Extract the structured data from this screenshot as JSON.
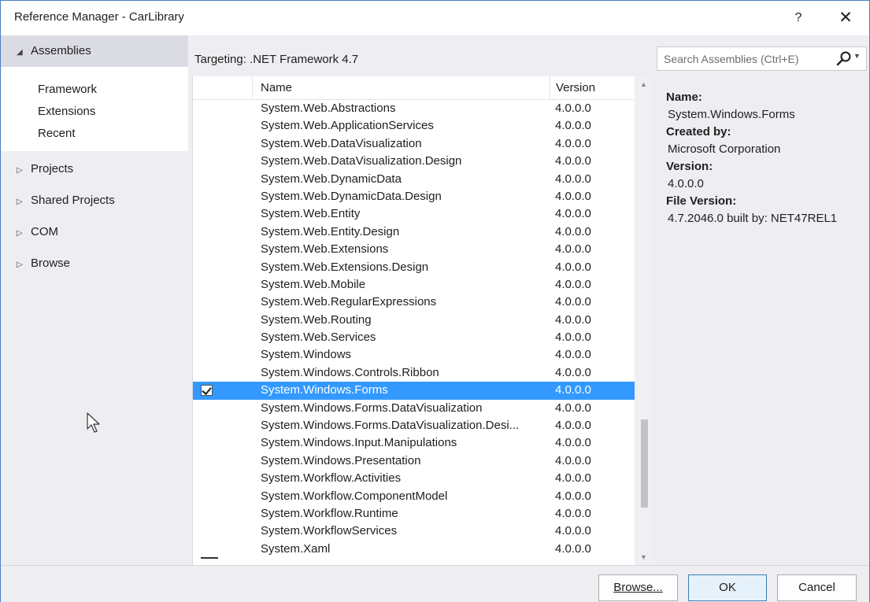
{
  "window": {
    "title": "Reference Manager - CarLibrary",
    "help": "?",
    "close": "✕"
  },
  "sidebar": {
    "assemblies": "Assemblies",
    "sub_items": [
      "Framework",
      "Extensions",
      "Recent"
    ],
    "nodes": [
      "Projects",
      "Shared Projects",
      "COM",
      "Browse"
    ]
  },
  "targeting": "Targeting: .NET Framework 4.7",
  "search": {
    "placeholder": "Search Assemblies (Ctrl+E)"
  },
  "table": {
    "columns": {
      "name": "Name",
      "version": "Version"
    },
    "rows": [
      {
        "name": "System.Web.Abstractions",
        "version": "4.0.0.0",
        "checked": false,
        "selected": false
      },
      {
        "name": "System.Web.ApplicationServices",
        "version": "4.0.0.0",
        "checked": false,
        "selected": false
      },
      {
        "name": "System.Web.DataVisualization",
        "version": "4.0.0.0",
        "checked": false,
        "selected": false
      },
      {
        "name": "System.Web.DataVisualization.Design",
        "version": "4.0.0.0",
        "checked": false,
        "selected": false
      },
      {
        "name": "System.Web.DynamicData",
        "version": "4.0.0.0",
        "checked": false,
        "selected": false
      },
      {
        "name": "System.Web.DynamicData.Design",
        "version": "4.0.0.0",
        "checked": false,
        "selected": false
      },
      {
        "name": "System.Web.Entity",
        "version": "4.0.0.0",
        "checked": false,
        "selected": false
      },
      {
        "name": "System.Web.Entity.Design",
        "version": "4.0.0.0",
        "checked": false,
        "selected": false
      },
      {
        "name": "System.Web.Extensions",
        "version": "4.0.0.0",
        "checked": false,
        "selected": false
      },
      {
        "name": "System.Web.Extensions.Design",
        "version": "4.0.0.0",
        "checked": false,
        "selected": false
      },
      {
        "name": "System.Web.Mobile",
        "version": "4.0.0.0",
        "checked": false,
        "selected": false
      },
      {
        "name": "System.Web.RegularExpressions",
        "version": "4.0.0.0",
        "checked": false,
        "selected": false
      },
      {
        "name": "System.Web.Routing",
        "version": "4.0.0.0",
        "checked": false,
        "selected": false
      },
      {
        "name": "System.Web.Services",
        "version": "4.0.0.0",
        "checked": false,
        "selected": false
      },
      {
        "name": "System.Windows",
        "version": "4.0.0.0",
        "checked": false,
        "selected": false
      },
      {
        "name": "System.Windows.Controls.Ribbon",
        "version": "4.0.0.0",
        "checked": false,
        "selected": false
      },
      {
        "name": "System.Windows.Forms",
        "version": "4.0.0.0",
        "checked": true,
        "selected": true
      },
      {
        "name": "System.Windows.Forms.DataVisualization",
        "version": "4.0.0.0",
        "checked": false,
        "selected": false
      },
      {
        "name": "System.Windows.Forms.DataVisualization.Desi...",
        "version": "4.0.0.0",
        "checked": false,
        "selected": false
      },
      {
        "name": "System.Windows.Input.Manipulations",
        "version": "4.0.0.0",
        "checked": false,
        "selected": false
      },
      {
        "name": "System.Windows.Presentation",
        "version": "4.0.0.0",
        "checked": false,
        "selected": false
      },
      {
        "name": "System.Workflow.Activities",
        "version": "4.0.0.0",
        "checked": false,
        "selected": false
      },
      {
        "name": "System.Workflow.ComponentModel",
        "version": "4.0.0.0",
        "checked": false,
        "selected": false
      },
      {
        "name": "System.Workflow.Runtime",
        "version": "4.0.0.0",
        "checked": false,
        "selected": false
      },
      {
        "name": "System.WorkflowServices",
        "version": "4.0.0.0",
        "checked": false,
        "selected": false
      },
      {
        "name": "System.Xaml",
        "version": "4.0.0.0",
        "checked": false,
        "selected": false
      }
    ]
  },
  "details": {
    "name_label": "Name:",
    "name_value": "System.Windows.Forms",
    "created_label": "Created by:",
    "created_value": "Microsoft Corporation",
    "version_label": "Version:",
    "version_value": "4.0.0.0",
    "fileversion_label": "File Version:",
    "fileversion_value": "4.7.2046.0 built by: NET47REL1"
  },
  "footer": {
    "browse": "Browse...",
    "ok": "OK",
    "cancel": "Cancel"
  },
  "colors": {
    "selection": "#3399ff",
    "window_bg": "#eeeef2",
    "accent_border": "#4a7fc1"
  },
  "icons": {
    "collapse": "triangle-down-icon",
    "expand": "triangle-right-icon",
    "search": "search-icon",
    "cursor": "mouse-pointer-icon"
  }
}
